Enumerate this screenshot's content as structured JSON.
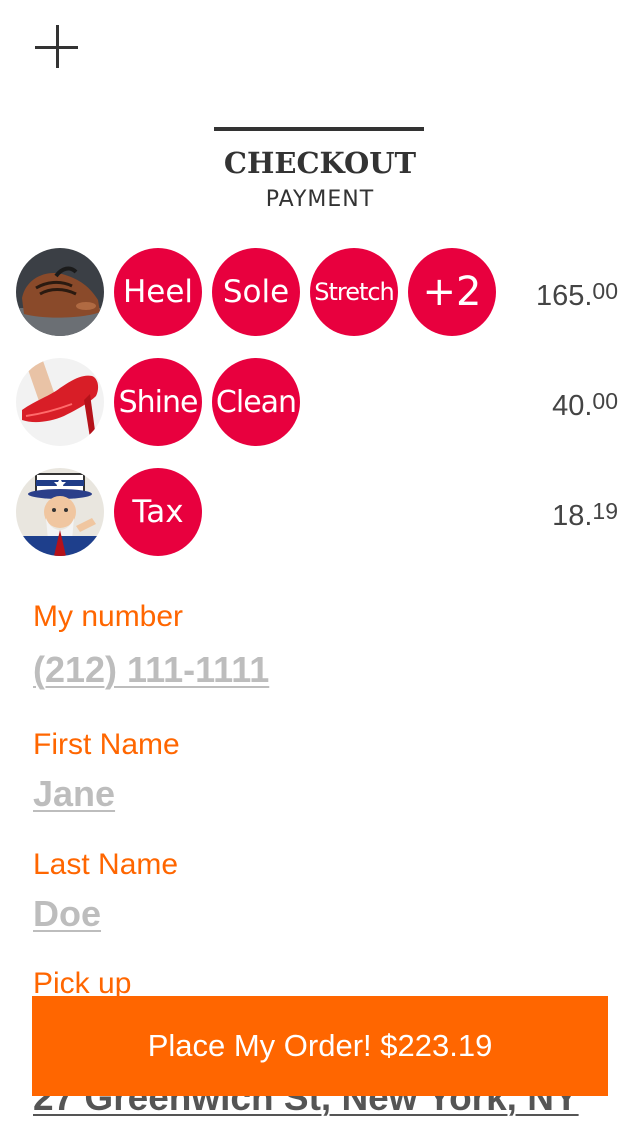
{
  "header": {
    "title": "CHECKOUT",
    "subtitle": "PAYMENT"
  },
  "items": [
    {
      "avatar": "shoe-boot-icon",
      "services": [
        "Heel",
        "Sole",
        "Stretch",
        "+2"
      ],
      "price_main": "165.",
      "price_cents": "00"
    },
    {
      "avatar": "red-heel-icon",
      "services": [
        "Shine",
        "Clean"
      ],
      "price_main": "40.",
      "price_cents": "00"
    },
    {
      "avatar": "uncle-sam-icon",
      "services": [
        "Tax"
      ],
      "price_main": "18.",
      "price_cents": "19"
    }
  ],
  "form": {
    "phone_label": "My number",
    "phone_value": "(212) 111-1111",
    "first_label": "First Name",
    "first_value": "Jane",
    "last_label": "Last Name",
    "last_value": "Doe",
    "pickup_label": "Pick up",
    "pickup_value": "27 Greenwich St, New York, NY"
  },
  "order_button": "Place My Order! $223.19",
  "colors": {
    "accent": "#ff6600",
    "chip": "#e8003e",
    "text": "#333333",
    "placeholder": "#bdbdbd"
  }
}
